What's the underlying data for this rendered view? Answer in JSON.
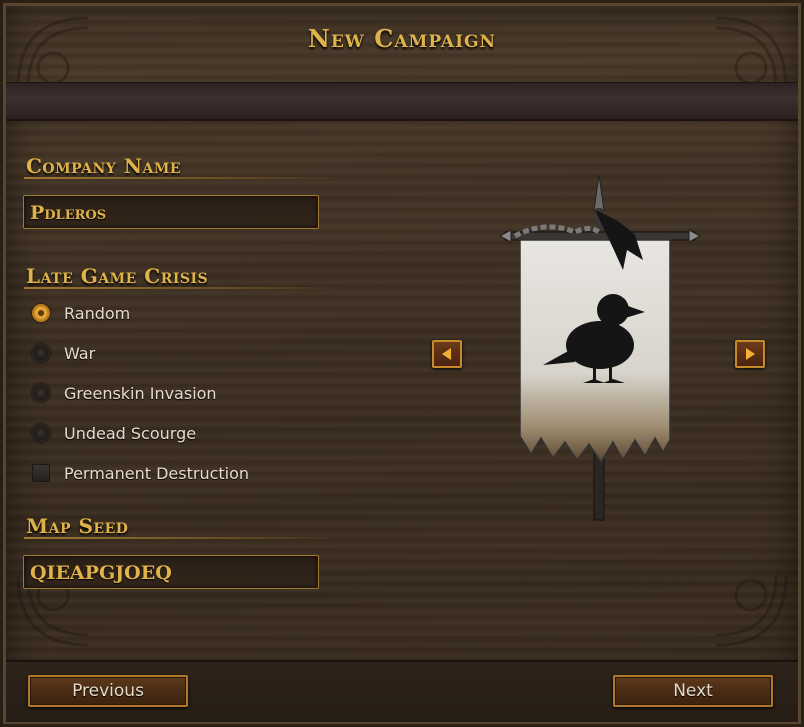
{
  "window": {
    "title": "New Campaign"
  },
  "company": {
    "label": "Company Name",
    "value": "Pdleros"
  },
  "crisis": {
    "label": "Late Game Crisis",
    "options": [
      {
        "label": "Random",
        "selected": true
      },
      {
        "label": "War",
        "selected": false
      },
      {
        "label": "Greenskin Invasion",
        "selected": false
      },
      {
        "label": "Undead Scourge",
        "selected": false
      }
    ],
    "checkbox": {
      "label": "Permanent Destruction",
      "checked": false
    }
  },
  "seed": {
    "label": "Map Seed",
    "value": "QIEAPGJOEQ"
  },
  "banner": {
    "emblem": "raven-icon",
    "prev_icon": "arrow-left-icon",
    "next_icon": "arrow-right-icon"
  },
  "footer": {
    "previous_label": "Previous",
    "next_label": "Next"
  },
  "colors": {
    "accent": "#e0b24a",
    "border_gold": "#c48a2c",
    "text": "#e6dccc"
  }
}
